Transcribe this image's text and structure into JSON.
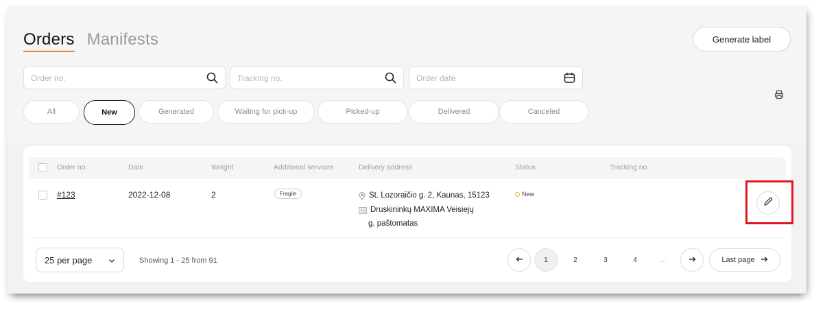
{
  "tabs": [
    {
      "label": "Orders",
      "active": true
    },
    {
      "label": "Manifests",
      "active": false
    }
  ],
  "header": {
    "generate_label": "Generate label"
  },
  "filters": {
    "order_no_placeholder": "Order no.",
    "tracking_no_placeholder": "Tracking no.",
    "order_date_placeholder": "Order date"
  },
  "status_filters": [
    "All",
    "New",
    "Generated",
    "Waiting for pick-up",
    "Picked-up",
    "Delivered",
    "Canceled"
  ],
  "active_status": "New",
  "table": {
    "columns": [
      "Order no.",
      "Date",
      "Weight",
      "Additional services",
      "Delivery address",
      "Status",
      "Tracking no."
    ],
    "rows": [
      {
        "order_no": "#123",
        "date": "2022-12-08",
        "weight": "2",
        "service": "Fragile",
        "address_line": "St. Lozoraičio g. 2, Kaunas, 15123",
        "terminal_line1": "Druskininkų MAXIMA Veisiejų",
        "terminal_line2": "g. paštomatas",
        "status": "New",
        "tracking_no": ""
      }
    ]
  },
  "footer": {
    "per_page": "25 per page",
    "showing": "Showing 1 - 25 from 91",
    "pages": [
      "1",
      "2",
      "3",
      "4",
      "..."
    ],
    "current_page": "1",
    "last_page": "Last page"
  },
  "colors": {
    "accent_underline": "#e8823a",
    "highlight_box": "#e0151f",
    "status_new": "#f1b323"
  }
}
